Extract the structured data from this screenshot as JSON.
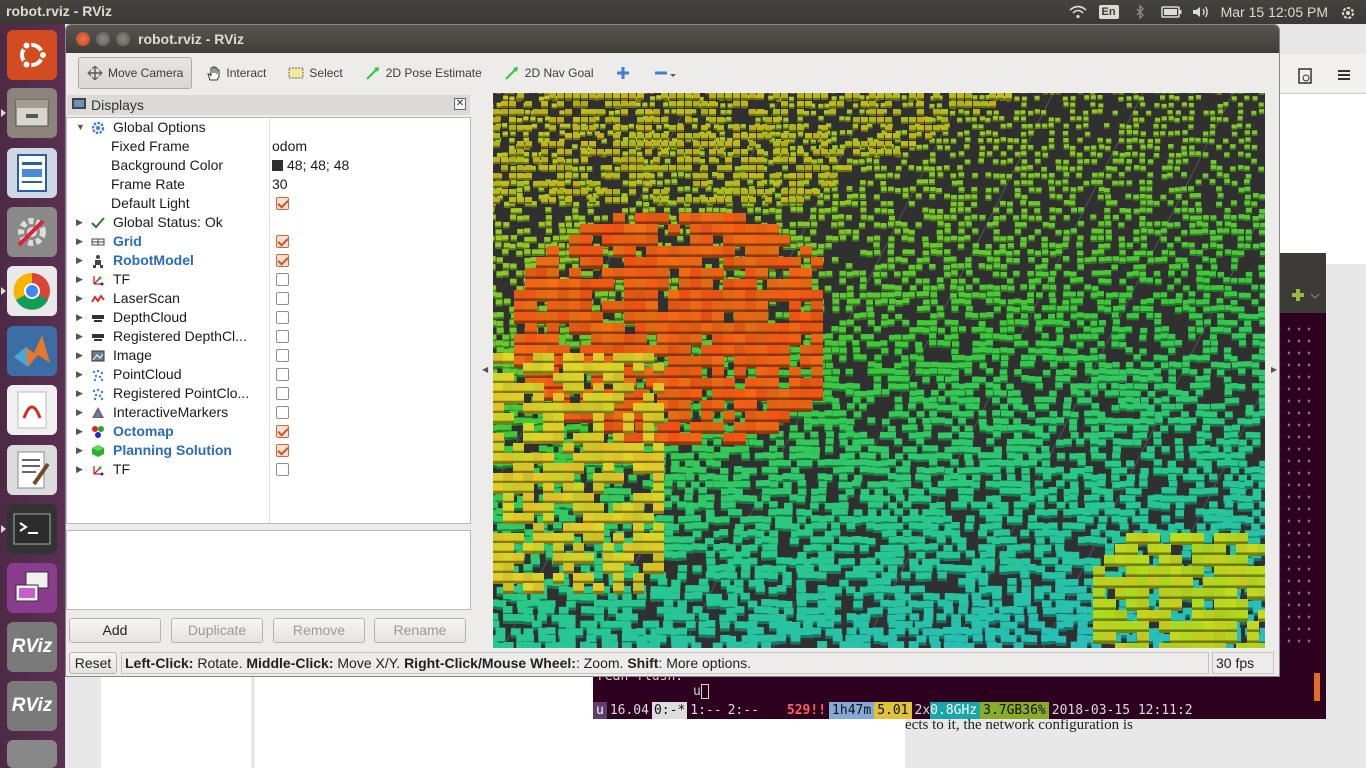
{
  "topbar": {
    "title": "robot.rviz - RViz",
    "keyboard": "En",
    "clock": "Mar 15 12:05 PM"
  },
  "launcher": {
    "items": [
      {
        "name": "ubuntu-icon"
      },
      {
        "name": "files-icon"
      },
      {
        "name": "writer-icon"
      },
      {
        "name": "settings-icon"
      },
      {
        "name": "chrome-icon"
      },
      {
        "name": "matlab-icon"
      },
      {
        "name": "pdf-icon"
      },
      {
        "name": "text-editor-icon"
      },
      {
        "name": "terminal-icon"
      },
      {
        "name": "remote-desktop-icon"
      },
      {
        "name": "rviz-icon",
        "label": "RViz"
      },
      {
        "name": "rviz-icon",
        "label": "RViz"
      }
    ]
  },
  "background_doc": {
    "text": "ects to it, the network configuration is"
  },
  "terminal": {
    "line1": "rean flush.",
    "line2": "u",
    "status": {
      "session": "u",
      "load": "16.04",
      "win0": "0:-*",
      "win1": "1:--",
      "win2": "2:--",
      "alert": "529!!",
      "uptime": "1h47m",
      "loadavg": "5.01",
      "cpu_prefix": "2x",
      "cpu": "0.8GHz",
      "mem": "3.7GB36%",
      "datetime": "2018-03-15 12:11:2"
    }
  },
  "rviz": {
    "title": "robot.rviz - RViz",
    "toolbar": {
      "move_camera": "Move Camera",
      "interact": "Interact",
      "select": "Select",
      "pose_estimate": "2D Pose Estimate",
      "nav_goal": "2D Nav Goal"
    },
    "displays": {
      "header": "Displays",
      "global_options": "Global Options",
      "fixed_frame_label": "Fixed Frame",
      "fixed_frame": "odom",
      "bg_color_label": "Background Color",
      "bg_color": "48; 48; 48",
      "bg_color_hex": "#303030",
      "frame_rate_label": "Frame Rate",
      "frame_rate": "30",
      "default_light_label": "Default Light",
      "global_status": "Global Status: Ok",
      "items": [
        {
          "label": "Grid",
          "bold": true,
          "checked": true
        },
        {
          "label": "RobotModel",
          "bold": true,
          "checked": true
        },
        {
          "label": "TF",
          "bold": false,
          "checked": false
        },
        {
          "label": "LaserScan",
          "bold": false,
          "checked": false
        },
        {
          "label": "DepthCloud",
          "bold": false,
          "checked": false
        },
        {
          "label": "Registered DepthCl...",
          "bold": false,
          "checked": false
        },
        {
          "label": "Image",
          "bold": false,
          "checked": false
        },
        {
          "label": "PointCloud",
          "bold": false,
          "checked": false
        },
        {
          "label": "Registered PointClo...",
          "bold": false,
          "checked": false
        },
        {
          "label": "InteractiveMarkers",
          "bold": false,
          "checked": false
        },
        {
          "label": "Octomap",
          "bold": true,
          "checked": true
        },
        {
          "label": "Planning Solution",
          "bold": true,
          "checked": true
        },
        {
          "label": "TF",
          "bold": false,
          "checked": false
        }
      ]
    },
    "buttons": {
      "add": "Add",
      "duplicate": "Duplicate",
      "remove": "Remove",
      "rename": "Rename"
    },
    "bottom": {
      "reset": "Reset",
      "help_1": "Left-Click:",
      "help_2": " Rotate. ",
      "help_3": "Middle-Click:",
      "help_4": " Move X/Y. ",
      "help_5": "Right-Click/Mouse Wheel:",
      "help_6": ": Zoom. ",
      "help_7": "Shift",
      "help_8": ": More options.",
      "fps": "30 fps"
    }
  }
}
